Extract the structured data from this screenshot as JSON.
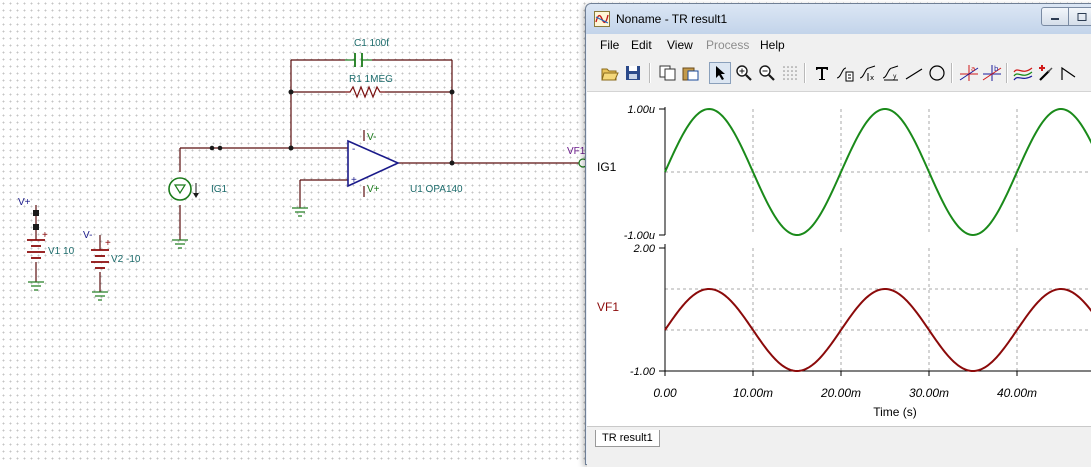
{
  "schematic": {
    "capacitor_label": "C1 100f",
    "resistor_label": "R1 1MEG",
    "current_source_label": "IG1",
    "opamp_label": "U1 OPA140",
    "output_label": "VF1",
    "supply1_label": "V1 10",
    "supply2_label": "V2 -10",
    "vplus": "V+",
    "vminus": "V-",
    "plus_sign": "+",
    "minus_sign": "-"
  },
  "window": {
    "title": "Noname - TR result1",
    "menu": [
      "File",
      "Edit",
      "View",
      "Process",
      "Help"
    ],
    "tab_label": "TR result1"
  },
  "plot": {
    "top_trace_label": "IG1",
    "bottom_trace_label": "VF1",
    "top_ticks": [
      "1.00u",
      "-1.00u"
    ],
    "bottom_ticks": [
      "2.00",
      "-1.00"
    ],
    "x_ticks": [
      "0.00",
      "10.00m",
      "20.00m",
      "30.00m",
      "40.00m"
    ],
    "x_axis_label": "Time (s)",
    "colors": {
      "top": "#1a8a1a",
      "bottom": "#8b0a0a"
    }
  },
  "chart_data": [
    {
      "type": "line",
      "series": [
        {
          "name": "IG1",
          "shape": "sine",
          "amplitude": 1e-06,
          "offset": 0,
          "period": 0.02,
          "phase_deg": 0
        }
      ],
      "xlabel": "Time (s)",
      "xlim": [
        0,
        0.048
      ],
      "ylim": [
        -1e-06,
        1e-06
      ],
      "grid": true
    },
    {
      "type": "line",
      "series": [
        {
          "name": "VF1",
          "shape": "sine",
          "amplitude": 1.0,
          "offset": 0,
          "period": 0.02,
          "phase_deg": 0
        }
      ],
      "xlabel": "Time (s)",
      "xlim": [
        0,
        0.048
      ],
      "ylim": [
        -1.0,
        2.0
      ],
      "grid": true
    }
  ]
}
